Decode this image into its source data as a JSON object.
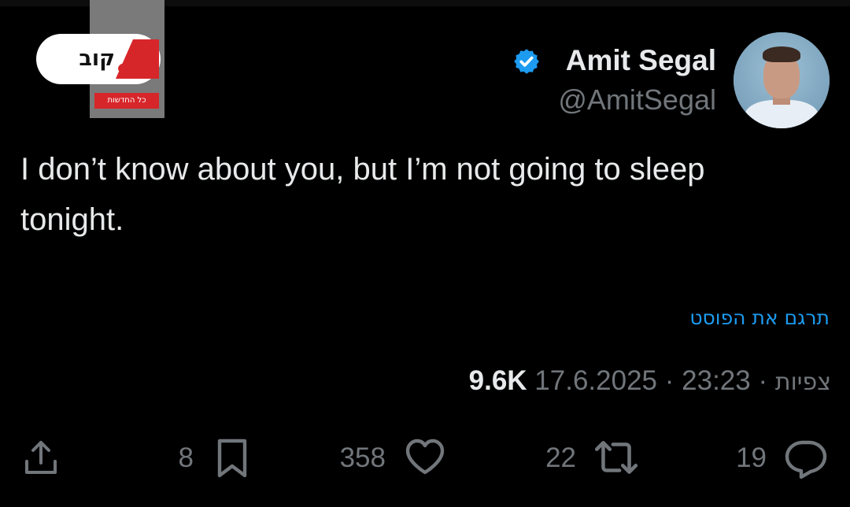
{
  "watermark": {
    "logo_text": "קוב",
    "logo_strip_text": "כל החדשות"
  },
  "author": {
    "name": "Amit Segal",
    "handle": "@AmitSegal",
    "verified": true,
    "verified_icon": "verified-badge-icon"
  },
  "tweet": {
    "text": "I don’t know about you, but I’m not going to sleep tonight."
  },
  "translate_link": "תרגם את הפוסט",
  "meta": {
    "date": "17.6.2025",
    "separator": "·",
    "time": "23:23",
    "views_label": "צפיות",
    "views_count": "9.6K"
  },
  "actions": {
    "share": {
      "icon": "share-icon"
    },
    "bookmark": {
      "icon": "bookmark-icon",
      "count": "8"
    },
    "like": {
      "icon": "heart-icon",
      "count": "358"
    },
    "retweet": {
      "icon": "retweet-icon",
      "count": "22"
    },
    "reply": {
      "icon": "reply-icon",
      "count": "19"
    }
  },
  "colors": {
    "background": "#000000",
    "text_primary": "#e7e9ea",
    "text_secondary": "#71767b",
    "accent": "#1d9bf0"
  }
}
